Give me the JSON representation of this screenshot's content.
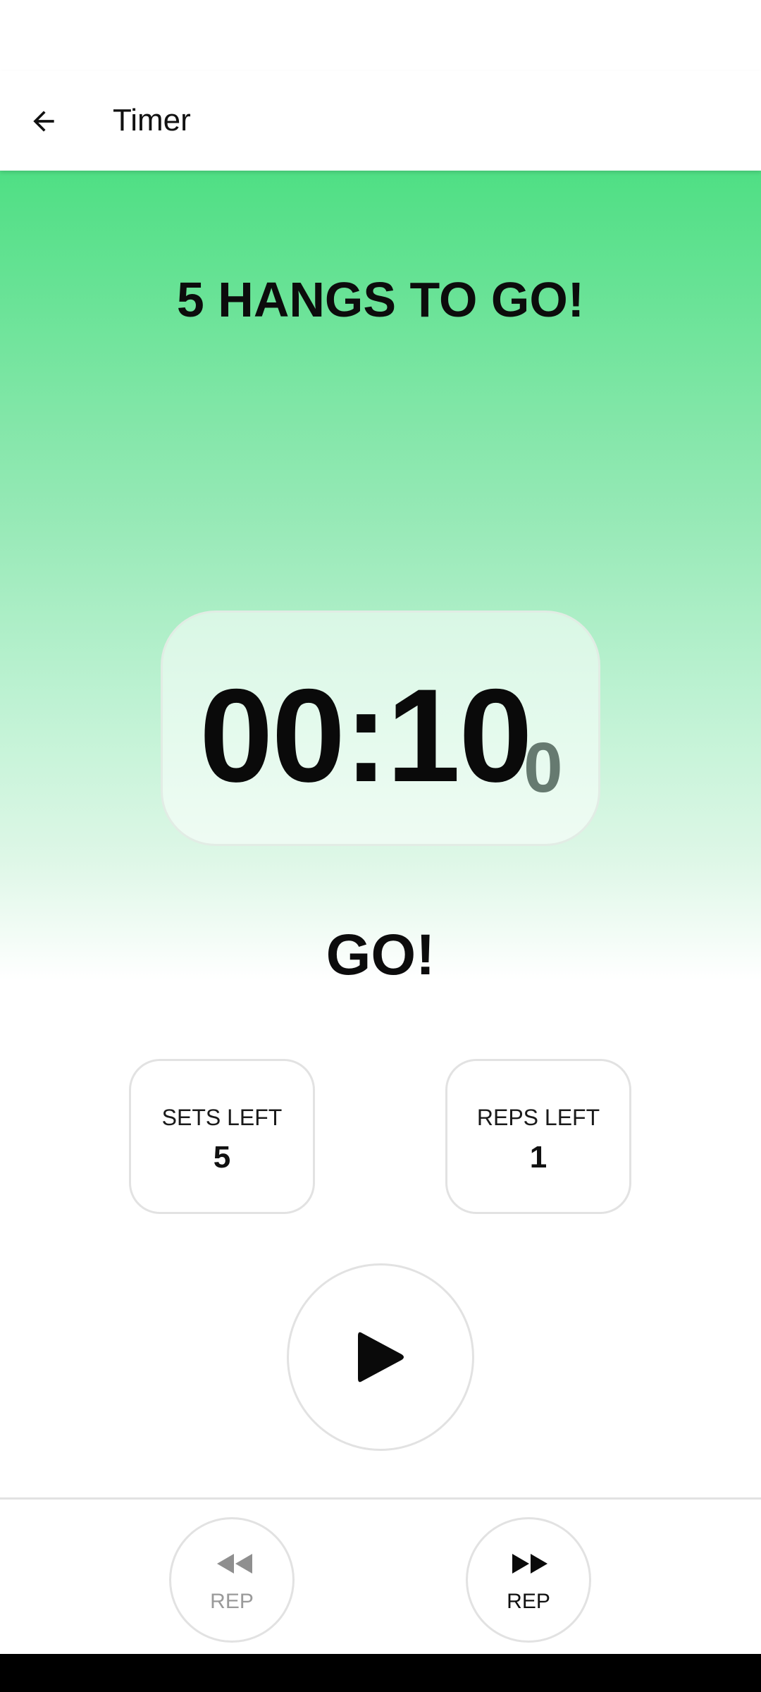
{
  "app_bar": {
    "title": "Timer",
    "back_icon": "arrow-left-icon"
  },
  "headline": "5 HANGS TO GO!",
  "timer": {
    "main": "00:10",
    "tenths": "0"
  },
  "phase": "GO!",
  "counters": {
    "sets": {
      "label": "SETS LEFT",
      "value": "5"
    },
    "reps": {
      "label": "REPS LEFT",
      "value": "1"
    }
  },
  "controls": {
    "play_icon": "play-icon",
    "prev_rep": {
      "label": "REP",
      "icon": "rewind-icon",
      "enabled": false
    },
    "next_rep": {
      "label": "REP",
      "icon": "fast-forward-icon",
      "enabled": true
    }
  },
  "colors": {
    "accent_green": "#4fdf84",
    "card_border": "#e2e2e2",
    "disabled_gray": "#9a9a9a"
  }
}
